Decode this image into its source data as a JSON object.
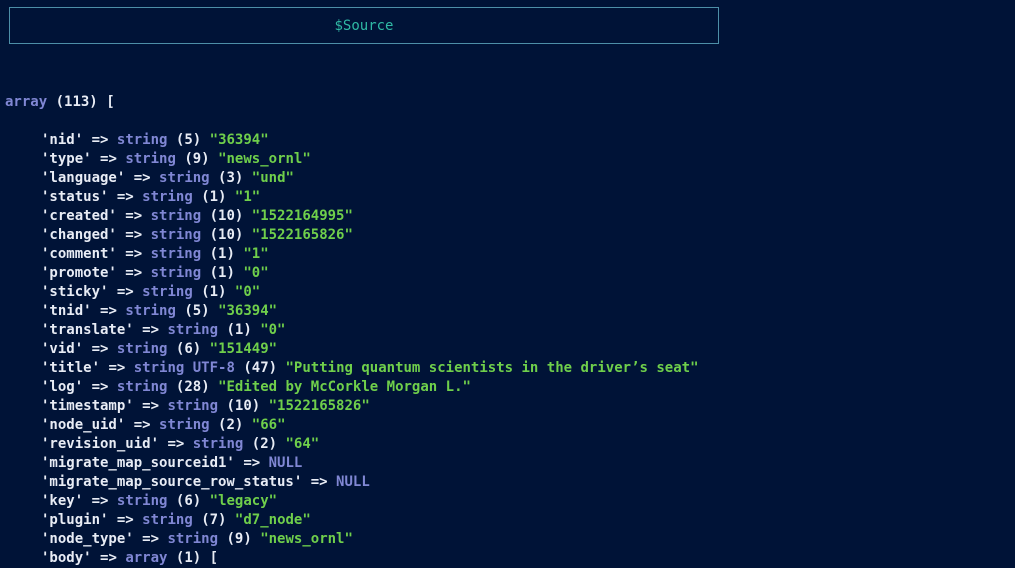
{
  "header": {
    "title": "$Source"
  },
  "colors": {
    "background": "#001337",
    "type_keyword": "#8087d4",
    "string_value": "#6fcf4b",
    "header_title": "#2fb9a5",
    "header_border": "#4d8fa8"
  },
  "dump": {
    "root": {
      "type": "array",
      "count": "(113)",
      "open": "["
    },
    "entries": [
      {
        "key": "'nid'",
        "type": "string",
        "len": "(5)",
        "value": "\"36394\""
      },
      {
        "key": "'type'",
        "type": "string",
        "len": "(9)",
        "value": "\"news_ornl\""
      },
      {
        "key": "'language'",
        "type": "string",
        "len": "(3)",
        "value": "\"und\""
      },
      {
        "key": "'status'",
        "type": "string",
        "len": "(1)",
        "value": "\"1\""
      },
      {
        "key": "'created'",
        "type": "string",
        "len": "(10)",
        "value": "\"1522164995\""
      },
      {
        "key": "'changed'",
        "type": "string",
        "len": "(10)",
        "value": "\"1522165826\""
      },
      {
        "key": "'comment'",
        "type": "string",
        "len": "(1)",
        "value": "\"1\""
      },
      {
        "key": "'promote'",
        "type": "string",
        "len": "(1)",
        "value": "\"0\""
      },
      {
        "key": "'sticky'",
        "type": "string",
        "len": "(1)",
        "value": "\"0\""
      },
      {
        "key": "'tnid'",
        "type": "string",
        "len": "(5)",
        "value": "\"36394\""
      },
      {
        "key": "'translate'",
        "type": "string",
        "len": "(1)",
        "value": "\"0\""
      },
      {
        "key": "'vid'",
        "type": "string",
        "len": "(6)",
        "value": "\"151449\""
      },
      {
        "key": "'title'",
        "type": "string UTF-8",
        "len": "(47)",
        "value": "\"Putting quantum scientists in the driver’s seat\""
      },
      {
        "key": "'log'",
        "type": "string",
        "len": "(28)",
        "value": "\"Edited by McCorkle Morgan L.\""
      },
      {
        "key": "'timestamp'",
        "type": "string",
        "len": "(10)",
        "value": "\"1522165826\""
      },
      {
        "key": "'node_uid'",
        "type": "string",
        "len": "(2)",
        "value": "\"66\""
      },
      {
        "key": "'revision_uid'",
        "type": "string",
        "len": "(2)",
        "value": "\"64\""
      },
      {
        "key": "'migrate_map_sourceid1'",
        "type": "NULL",
        "len": "",
        "value": ""
      },
      {
        "key": "'migrate_map_source_row_status'",
        "type": "NULL",
        "len": "",
        "value": ""
      },
      {
        "key": "'key'",
        "type": "string",
        "len": "(6)",
        "value": "\"legacy\""
      },
      {
        "key": "'plugin'",
        "type": "string",
        "len": "(7)",
        "value": "\"d7_node\""
      },
      {
        "key": "'node_type'",
        "type": "string",
        "len": "(9)",
        "value": "\"news_ornl\""
      },
      {
        "key": "'body'",
        "type": "array",
        "len": "(1)",
        "value": "["
      }
    ],
    "arrow": "=>"
  }
}
